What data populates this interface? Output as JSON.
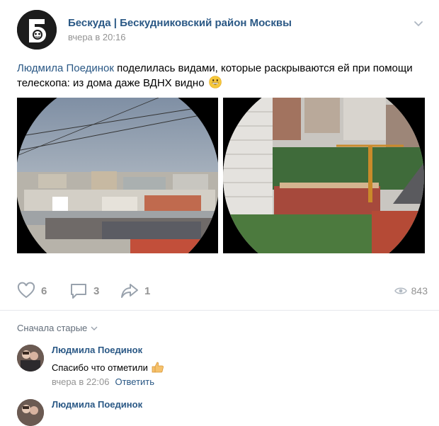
{
  "post": {
    "group_name": "Бескуда | Бескудниковский район Москвы",
    "time": "вчера в 20:16",
    "author_mention": "Людмила Поединок",
    "text": " поделилась видами, которые раскрываются ей при помощи телескопа: из дома даже ВДНХ видно",
    "emoji": "grinning-face-emoji"
  },
  "actions": {
    "likes": "6",
    "comments": "3",
    "shares": "1",
    "views": "843"
  },
  "comments_section": {
    "sort_label": "Сначала старые"
  },
  "comments": [
    {
      "author": "Людмила Поединок",
      "text": "Спасибо что отметили",
      "time": "вчера в 22:06",
      "reply_label": "Ответить"
    },
    {
      "author": "Людмила Поединок"
    }
  ],
  "colors": {
    "link": "#2a5885",
    "muted": "#939393",
    "divider": "#e7e8ec"
  }
}
